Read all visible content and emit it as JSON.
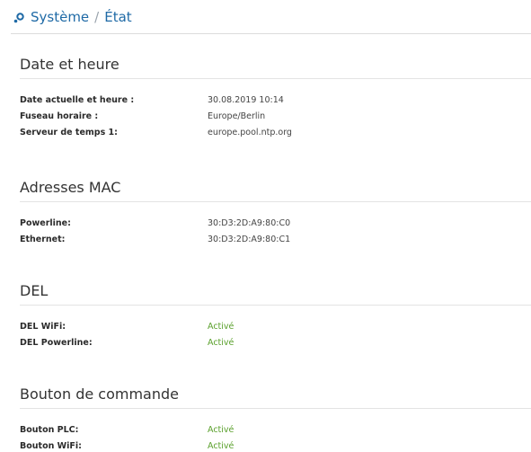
{
  "header": {
    "icon": "system-cog-icon",
    "breadcrumb": [
      "Système",
      "État"
    ],
    "separator": "/",
    "accent": "#1f6aa6"
  },
  "sections": [
    {
      "title": "Date et heure",
      "rows": [
        {
          "label": "Date actuelle et heure :",
          "value": "30.08.2019 10:14"
        },
        {
          "label": "Fuseau horaire :",
          "value": "Europe/Berlin"
        },
        {
          "label": "Serveur de temps 1:",
          "value": "europe.pool.ntp.org"
        }
      ]
    },
    {
      "title": "Adresses MAC",
      "rows": [
        {
          "label": "Powerline:",
          "value": "30:D3:2D:A9:80:C0"
        },
        {
          "label": "Ethernet:",
          "value": "30:D3:2D:A9:80:C1"
        }
      ]
    },
    {
      "title": "DEL",
      "rows": [
        {
          "label": "DEL WiFi:",
          "value": "Activé"
        },
        {
          "label": "DEL Powerline:",
          "value": "Activé"
        }
      ]
    },
    {
      "title": "Bouton de commande",
      "rows": [
        {
          "label": "Bouton PLC:",
          "value": "Activé"
        },
        {
          "label": "Bouton WiFi:",
          "value": "Activé"
        }
      ]
    }
  ],
  "colors": {
    "active": "#5aa02c",
    "rule": "#e3e3e3"
  }
}
